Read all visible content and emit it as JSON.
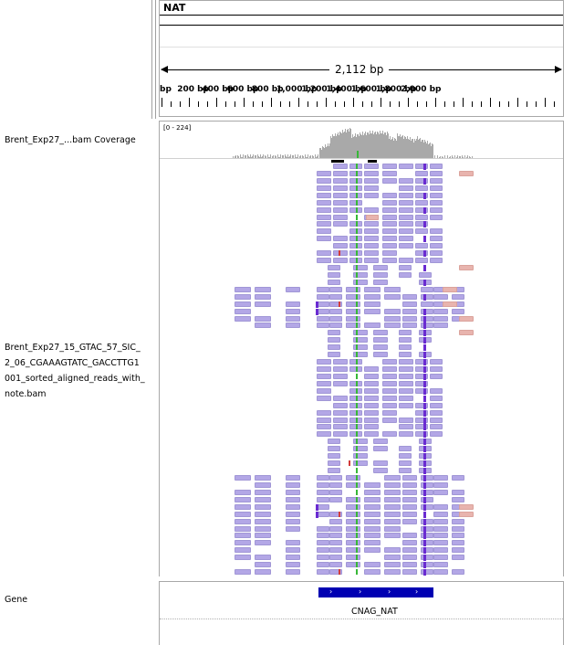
{
  "header": {
    "chromosome": "NAT",
    "span_label": "2,112 bp",
    "ticks": [
      "bp",
      "200 bp",
      "400 bp",
      "600 bp",
      "800 bp",
      "1,000 bp",
      "1,200 bp",
      "1,400 bp",
      "1,600 bp",
      "1,800 bp",
      "2,000 bp"
    ]
  },
  "tracks": {
    "coverage_label": "Brent_Exp27_...bam Coverage",
    "coverage_range": "[0 - 224]",
    "alignment_label_lines": [
      "Brent_Exp27_15_GTAC_57_SIC_",
      "2_06_CGAAAGTATC_GACCTTG1",
      "001_sorted_aligned_reads_with_",
      "note.bam"
    ],
    "gene_label": "Gene",
    "gene_name": "CNAG_NAT"
  },
  "colors": {
    "read": "#b3a7e6",
    "read_pink": "#e8b4ae",
    "insertion": "#6a2bd1",
    "gene": "#0000b2",
    "coverage": "#a9a9a9"
  }
}
